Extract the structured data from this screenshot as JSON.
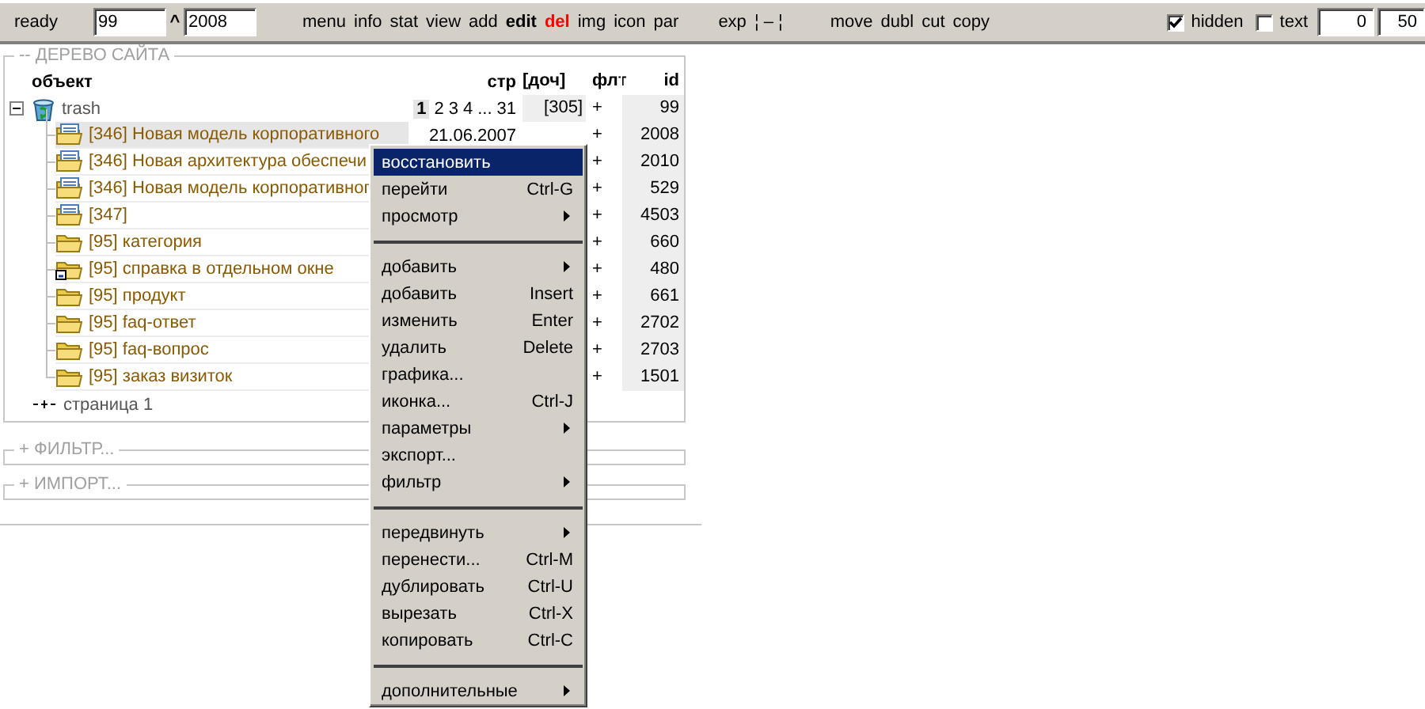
{
  "toolbar": {
    "status": "ready",
    "id_field": "99",
    "up_label": "^",
    "parent_field": "2008",
    "links": [
      {
        "label": "menu",
        "kind": "plain"
      },
      {
        "label": "info",
        "kind": "plain"
      },
      {
        "label": "stat",
        "kind": "plain"
      },
      {
        "label": "view",
        "kind": "plain"
      },
      {
        "label": "add",
        "kind": "plain"
      },
      {
        "label": "edit",
        "kind": "bold"
      },
      {
        "label": "del",
        "kind": "danger"
      },
      {
        "label": "img",
        "kind": "plain"
      },
      {
        "label": "icon",
        "kind": "plain"
      },
      {
        "label": "par",
        "kind": "plain"
      }
    ],
    "expand_links": [
      {
        "label": "exp"
      },
      {
        "label": "¦ – ¦"
      }
    ],
    "action_links": [
      {
        "label": "move"
      },
      {
        "label": "dubl"
      },
      {
        "label": "cut"
      },
      {
        "label": "copy"
      }
    ],
    "checkboxes": [
      {
        "label": "hidden",
        "checked": true
      },
      {
        "label": "text",
        "checked": false
      }
    ],
    "range_from": "0",
    "range_to": "50"
  },
  "tree_section": {
    "title": "-- ДЕРЕВО САЙТА",
    "columns": {
      "object": "объект",
      "pages": "стр",
      "children": "[доч]",
      "filter": "флт",
      "id": "id"
    },
    "nodes": [
      {
        "kind": "trash",
        "label": "trash",
        "pages": [
          {
            "label": "1",
            "selected": true
          },
          {
            "label": "2",
            "selected": false
          },
          {
            "label": "3",
            "selected": false
          },
          {
            "label": "4",
            "selected": false
          },
          {
            "label": "...",
            "selected": false
          },
          {
            "label": "31",
            "selected": false
          }
        ],
        "child_count": "[305]",
        "filter": "+",
        "id": "99",
        "children": [
          {
            "kind": "page-folder",
            "label": "[346] Новая модель корпоративного",
            "date": "21.06.2007",
            "filter": "+",
            "id": "2008",
            "selected": true
          },
          {
            "kind": "page-folder",
            "label": "[346] Новая архитектура обеспечи",
            "filter": "+",
            "id": "2010",
            "selected": false
          },
          {
            "kind": "page-folder",
            "label": "[346] Новая модель корпоративног",
            "filter": "+",
            "id": "529",
            "selected": false
          },
          {
            "kind": "page-folder",
            "label": "[347]",
            "filter": "+",
            "id": "4503",
            "selected": false
          },
          {
            "kind": "folder",
            "label": "[95] категория",
            "filter": "+",
            "id": "660",
            "selected": false
          },
          {
            "kind": "link-folder",
            "label": "[95] справка в отдельном окне",
            "filter": "+",
            "id": "480",
            "selected": false
          },
          {
            "kind": "folder",
            "label": "[95] продукт",
            "filter": "+",
            "id": "661",
            "selected": false
          },
          {
            "kind": "folder",
            "label": "[95] faq-ответ",
            "filter": "+",
            "id": "2702",
            "selected": false
          },
          {
            "kind": "folder",
            "label": "[95] faq-вопрос",
            "filter": "+",
            "id": "2703",
            "selected": false
          },
          {
            "kind": "folder",
            "label": "[95] заказ визиток",
            "filter": "+",
            "id": "1501",
            "selected": false
          }
        ]
      },
      {
        "kind": "page",
        "label": "страница 1"
      }
    ]
  },
  "collapsed_sections": [
    {
      "title": "+ ФИЛЬТР..."
    },
    {
      "title": "+ ИМПОРТ..."
    }
  ],
  "context_menu": [
    {
      "kind": "item",
      "label": "восстановить",
      "selected": true,
      "submenu": false
    },
    {
      "kind": "item",
      "label": "перейти",
      "shortcut": "Ctrl-G",
      "selected": false,
      "submenu": false
    },
    {
      "kind": "item",
      "label": "просмотр",
      "selected": false,
      "submenu": true
    },
    {
      "kind": "separator"
    },
    {
      "kind": "item",
      "label": "добавить",
      "selected": false,
      "submenu": true
    },
    {
      "kind": "item",
      "label": "добавить",
      "shortcut": "Insert",
      "selected": false,
      "submenu": false
    },
    {
      "kind": "item",
      "label": "изменить",
      "shortcut": "Enter",
      "selected": false,
      "submenu": false
    },
    {
      "kind": "item",
      "label": "удалить",
      "shortcut": "Delete",
      "selected": false,
      "submenu": false
    },
    {
      "kind": "item",
      "label": "графика...",
      "selected": false,
      "submenu": false
    },
    {
      "kind": "item",
      "label": "иконка...",
      "shortcut": "Ctrl-J",
      "selected": false,
      "submenu": false
    },
    {
      "kind": "item",
      "label": "параметры",
      "selected": false,
      "submenu": true
    },
    {
      "kind": "item",
      "label": "экспорт...",
      "selected": false,
      "submenu": false
    },
    {
      "kind": "item",
      "label": "фильтр",
      "selected": false,
      "submenu": true
    },
    {
      "kind": "separator"
    },
    {
      "kind": "item",
      "label": "передвинуть",
      "selected": false,
      "submenu": true
    },
    {
      "kind": "item",
      "label": "перенести...",
      "shortcut": "Ctrl-M",
      "selected": false,
      "submenu": false
    },
    {
      "kind": "item",
      "label": "дублировать",
      "shortcut": "Ctrl-U",
      "selected": false,
      "submenu": false
    },
    {
      "kind": "item",
      "label": "вырезать",
      "shortcut": "Ctrl-X",
      "selected": false,
      "submenu": false
    },
    {
      "kind": "item",
      "label": "копировать",
      "shortcut": "Ctrl-C",
      "selected": false,
      "submenu": false
    },
    {
      "kind": "separator"
    },
    {
      "kind": "item",
      "label": "дополнительные",
      "selected": false,
      "submenu": true
    }
  ]
}
